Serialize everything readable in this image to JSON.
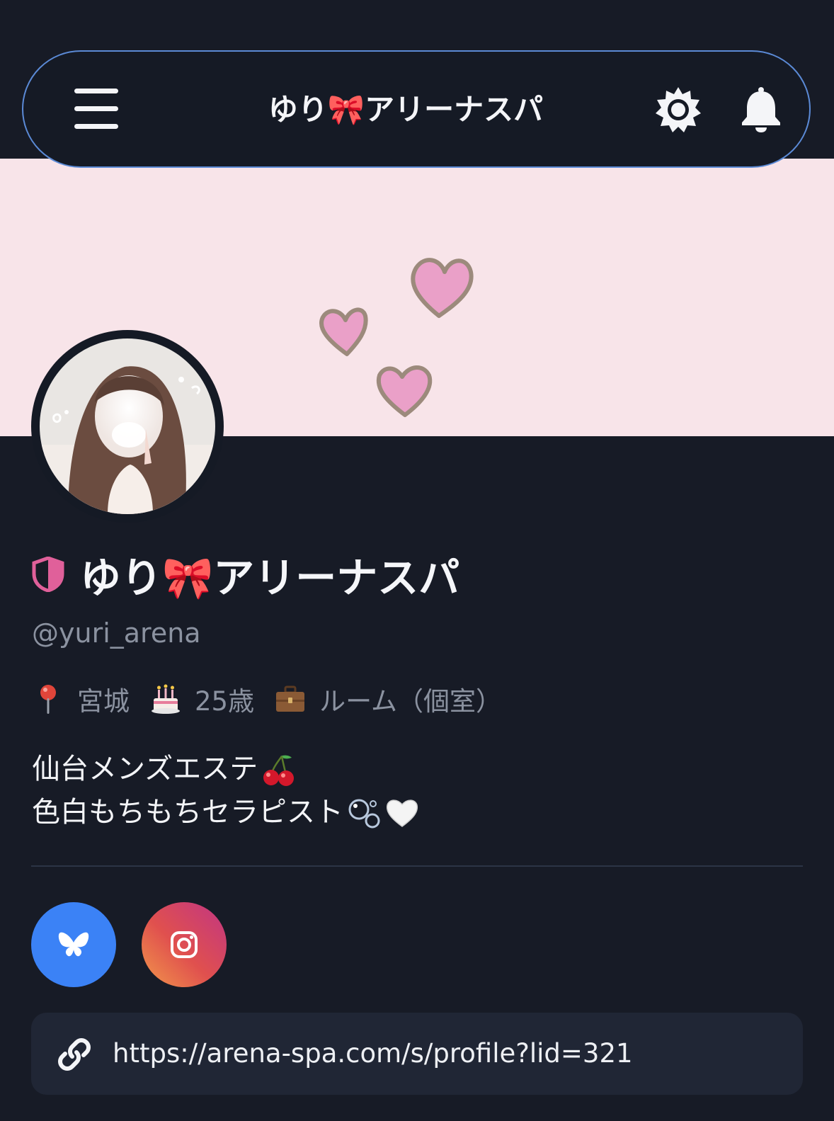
{
  "header": {
    "title": "ゆり🎀アリーナスパ",
    "menu_icon": "hamburger-menu-icon",
    "settings_icon": "gear-icon",
    "notifications_icon": "bell-icon"
  },
  "profile": {
    "display_name": "ゆり🎀アリーナスパ",
    "handle": "@yuri_arena",
    "verified_icon": "shield-icon",
    "meta": [
      {
        "icon": "pin-icon",
        "label": "宮城"
      },
      {
        "icon": "cake-icon",
        "label": "25歳"
      },
      {
        "icon": "briefcase-icon",
        "label": "ルーム（個室）"
      }
    ],
    "bio": {
      "line1": "仙台メンズエステ",
      "line1_emoji": "cherries-icon",
      "line2": "色白もちもちセラピスト",
      "line2_emojis": [
        "bubbles-icon",
        "white-heart-icon"
      ]
    }
  },
  "social": [
    {
      "name": "bluesky",
      "icon": "butterfly-icon",
      "color": "#3b82f6"
    },
    {
      "name": "instagram",
      "icon": "instagram-icon",
      "color": "#e0504e"
    }
  ],
  "link": {
    "icon": "link-icon",
    "url": "https://arena-spa.com/s/profile?lid=321"
  },
  "colors": {
    "background": "#171b26",
    "banner": "#f8e4e9",
    "header_border": "#5b8ad6",
    "accent_pink": "#e0609a",
    "muted_text": "#8b92a0"
  }
}
